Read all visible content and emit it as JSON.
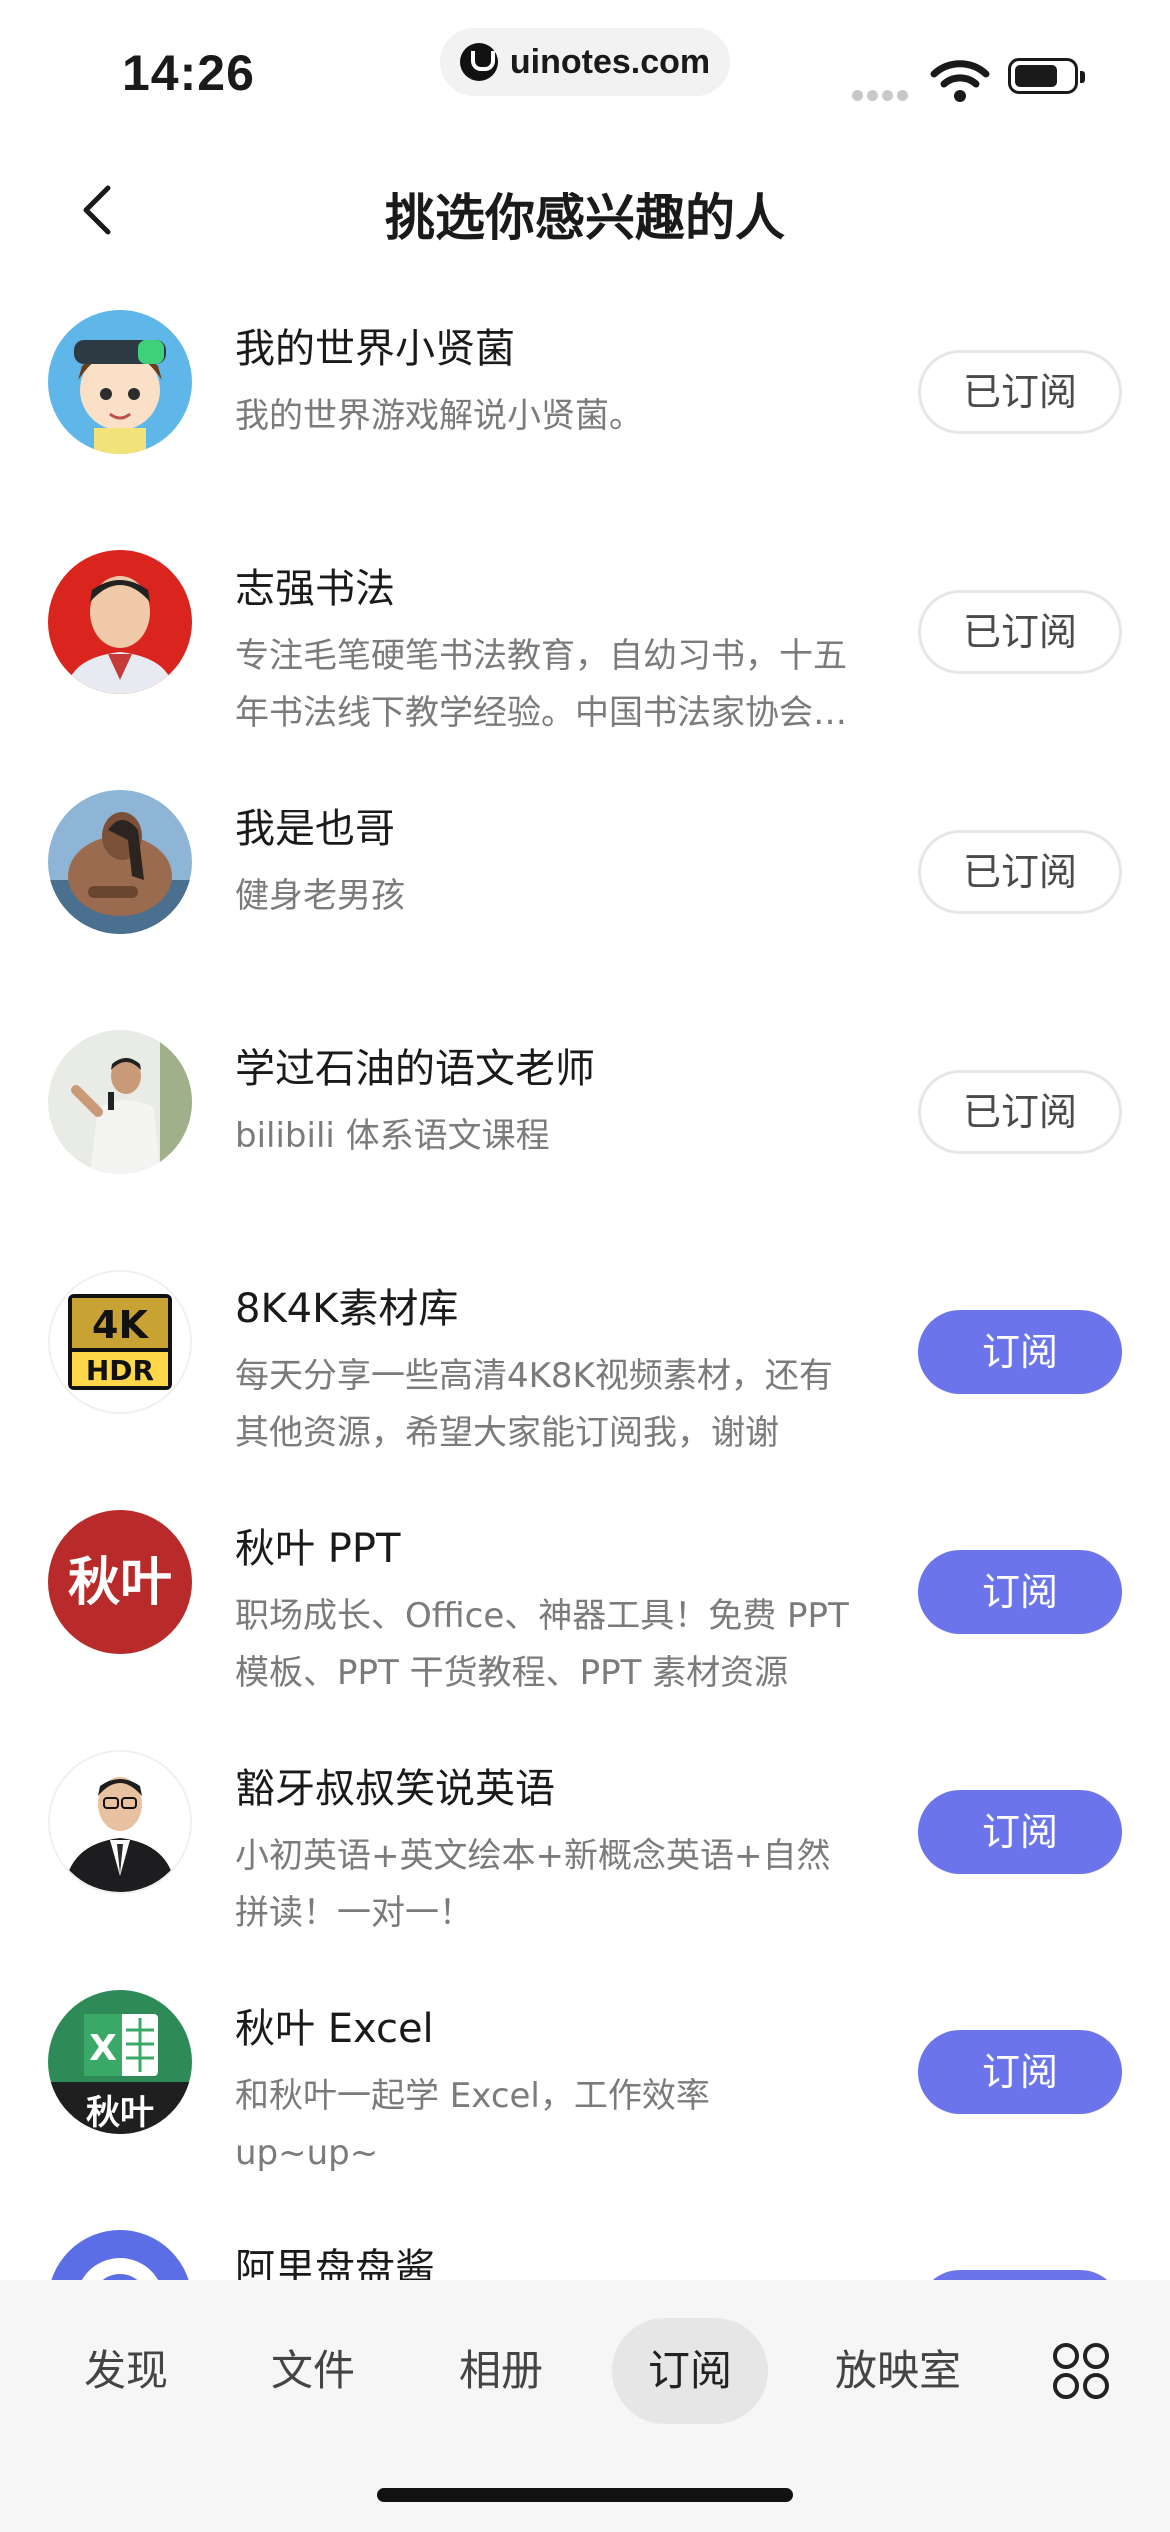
{
  "status_bar": {
    "time": "14:26",
    "url": "uinotes.com"
  },
  "header": {
    "title": "挑选你感兴趣的人"
  },
  "items": [
    {
      "name": "我的世界小贤菌",
      "desc": "我的世界游戏解说小贤菌。",
      "button": "已订阅",
      "subscribed": true
    },
    {
      "name": "志强书法",
      "desc": "专注毛笔硬笔书法教育，自幼习书，十五年书法线下教学经验。中国书法家协会会员",
      "button": "已订阅",
      "subscribed": true
    },
    {
      "name": "我是也哥",
      "desc": "健身老男孩",
      "button": "已订阅",
      "subscribed": true
    },
    {
      "name": "学过石油的语文老师",
      "desc": "bilibili 体系语文课程",
      "button": "已订阅",
      "subscribed": true
    },
    {
      "name": "8K4K素材库",
      "desc": "每天分享一些高清4K8K视频素材，还有其他资源，希望大家能订阅我，谢谢",
      "button": "订阅",
      "subscribed": false
    },
    {
      "name": "秋叶 PPT",
      "desc": "职场成长、Office、神器工具！免费 PPT 模板、PPT 干货教程、PPT 素材资源",
      "button": "订阅",
      "subscribed": false
    },
    {
      "name": "豁牙叔叔笑说英语",
      "desc": "小初英语+英文绘本+新概念英语+自然拼读！一对一！",
      "button": "订阅",
      "subscribed": false
    },
    {
      "name": "秋叶 Excel",
      "desc": "和秋叶一起学 Excel，工作效率 up~up~",
      "button": "订阅",
      "subscribed": false
    },
    {
      "name": "阿里盘盘酱",
      "desc": "",
      "button": "订阅",
      "subscribed": false
    }
  ],
  "avatars": {
    "a4": {
      "line1": "4K",
      "line2": "HDR"
    },
    "a5": {
      "text": "秋叶"
    },
    "a7": {
      "sheet": "X",
      "text": "秋叶"
    }
  },
  "tabs": [
    {
      "label": "发现"
    },
    {
      "label": "文件"
    },
    {
      "label": "相册"
    },
    {
      "label": "订阅",
      "active": true
    },
    {
      "label": "放映室"
    }
  ],
  "colors": {
    "accent": "#6b74ea",
    "subscribed_border": "#e6e6e6"
  }
}
